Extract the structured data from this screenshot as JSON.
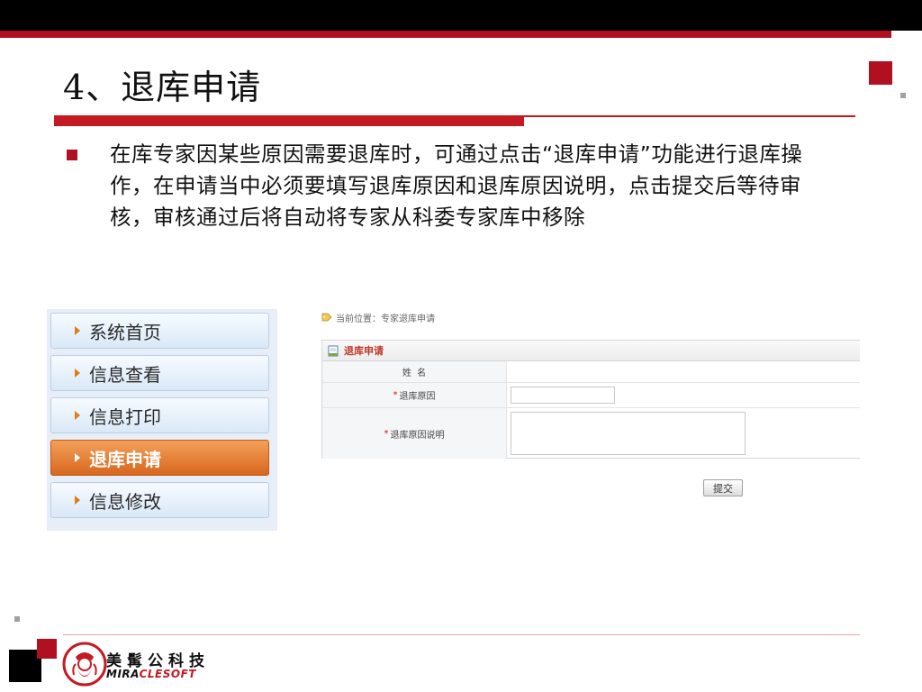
{
  "slide": {
    "title": "4、退库申请",
    "body": "在库专家因某些原因需要退库时，可通过点击“退库申请”功能进行退库操作，在申请当中必须要填写退库原因和退库原因说明，点击提交后等待审核，审核通过后将自动将专家从科委专家库中移除"
  },
  "menu": {
    "items": [
      {
        "label": "系统首页"
      },
      {
        "label": "信息查看"
      },
      {
        "label": "信息打印"
      },
      {
        "label": "退库申请",
        "active": true
      },
      {
        "label": "信息修改"
      }
    ]
  },
  "form": {
    "breadcrumb": "当前位置：专家退库申请",
    "header": "退库申请",
    "name_label": "姓  名",
    "reason_label": "退库原因",
    "reason_detail_label": "退库原因说明",
    "required_mark": "*",
    "submit_label": "提交"
  },
  "logo": {
    "cn": "美髯公科技",
    "en_a": "MIRA",
    "en_b": "CLESOFT"
  },
  "colors": {
    "accent_red": "#c41a24",
    "menu_active": "#d8661e",
    "menu_bg": "#e7eef7"
  }
}
